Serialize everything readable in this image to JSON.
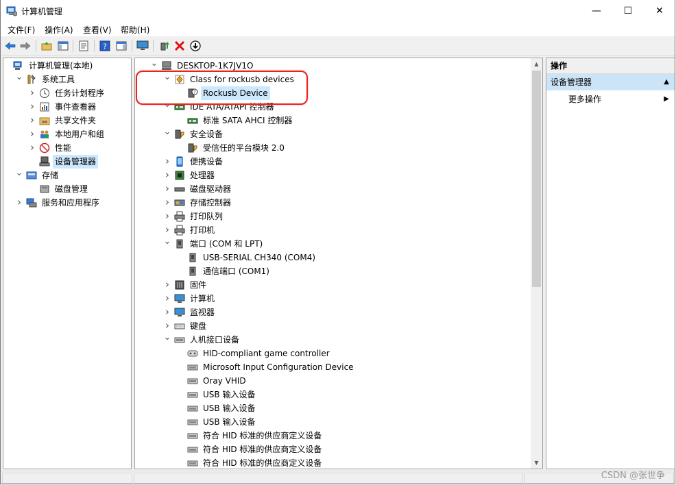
{
  "window": {
    "title": "计算机管理",
    "minimize_glyph": "—",
    "maximize_glyph": "☐",
    "close_glyph": "✕"
  },
  "menu": [
    "文件(F)",
    "操作(A)",
    "查看(V)",
    "帮助(H)"
  ],
  "toolbar_icons": [
    "back-arrow-icon",
    "forward-arrow-icon",
    "up-folder-icon",
    "show-hide-console-tree-icon",
    "properties-icon",
    "help-icon",
    "show-hide-action-pane-icon",
    "monitor-icon",
    "update-driver-icon",
    "uninstall-icon",
    "scan-hardware-icon"
  ],
  "left_tree": [
    {
      "label": "计算机管理(本地)",
      "indent": 0,
      "expand": "",
      "icon": "computer-management-icon"
    },
    {
      "label": "系统工具",
      "indent": 1,
      "expand": "v",
      "icon": "tools-icon"
    },
    {
      "label": "任务计划程序",
      "indent": 2,
      "expand": ">",
      "icon": "clock-icon"
    },
    {
      "label": "事件查看器",
      "indent": 2,
      "expand": ">",
      "icon": "event-viewer-icon"
    },
    {
      "label": "共享文件夹",
      "indent": 2,
      "expand": ">",
      "icon": "shared-folder-icon"
    },
    {
      "label": "本地用户和组",
      "indent": 2,
      "expand": ">",
      "icon": "users-icon"
    },
    {
      "label": "性能",
      "indent": 2,
      "expand": ">",
      "icon": "performance-icon"
    },
    {
      "label": "设备管理器",
      "indent": 2,
      "expand": "",
      "icon": "device-manager-icon",
      "selected": true
    },
    {
      "label": "存储",
      "indent": 1,
      "expand": "v",
      "icon": "storage-icon"
    },
    {
      "label": "磁盘管理",
      "indent": 2,
      "expand": "",
      "icon": "disk-management-icon"
    },
    {
      "label": "服务和应用程序",
      "indent": 1,
      "expand": ">",
      "icon": "services-icon"
    }
  ],
  "device_tree": [
    {
      "label": "DESKTOP-1K7JV1O",
      "indent": 0,
      "expand": "v",
      "icon": "computer-icon"
    },
    {
      "label": "Class for rockusb devices",
      "indent": 1,
      "expand": "v",
      "icon": "rockusb-class-icon"
    },
    {
      "label": "Rockusb Device",
      "indent": 2,
      "expand": "",
      "icon": "unknown-device-icon",
      "selected": true
    },
    {
      "label": "IDE ATA/ATAPI 控制器",
      "indent": 1,
      "expand": "v",
      "icon": "ide-controller-icon"
    },
    {
      "label": "标准 SATA AHCI 控制器",
      "indent": 2,
      "expand": "",
      "icon": "ide-controller-icon"
    },
    {
      "label": "安全设备",
      "indent": 1,
      "expand": "v",
      "icon": "security-device-icon"
    },
    {
      "label": "受信任的平台模块 2.0",
      "indent": 2,
      "expand": "",
      "icon": "security-device-icon"
    },
    {
      "label": "便携设备",
      "indent": 1,
      "expand": ">",
      "icon": "portable-device-icon"
    },
    {
      "label": "处理器",
      "indent": 1,
      "expand": ">",
      "icon": "processor-icon"
    },
    {
      "label": "磁盘驱动器",
      "indent": 1,
      "expand": ">",
      "icon": "disk-drive-icon"
    },
    {
      "label": "存储控制器",
      "indent": 1,
      "expand": ">",
      "icon": "storage-controller-icon"
    },
    {
      "label": "打印队列",
      "indent": 1,
      "expand": ">",
      "icon": "printer-icon"
    },
    {
      "label": "打印机",
      "indent": 1,
      "expand": ">",
      "icon": "printer-icon"
    },
    {
      "label": "端口 (COM 和 LPT)",
      "indent": 1,
      "expand": "v",
      "icon": "port-icon"
    },
    {
      "label": "USB-SERIAL CH340 (COM4)",
      "indent": 2,
      "expand": "",
      "icon": "port-icon"
    },
    {
      "label": "通信端口 (COM1)",
      "indent": 2,
      "expand": "",
      "icon": "port-icon"
    },
    {
      "label": "固件",
      "indent": 1,
      "expand": ">",
      "icon": "firmware-icon"
    },
    {
      "label": "计算机",
      "indent": 1,
      "expand": ">",
      "icon": "monitor-icon"
    },
    {
      "label": "监视器",
      "indent": 1,
      "expand": ">",
      "icon": "monitor-icon"
    },
    {
      "label": "键盘",
      "indent": 1,
      "expand": ">",
      "icon": "keyboard-icon"
    },
    {
      "label": "人机接口设备",
      "indent": 1,
      "expand": "v",
      "icon": "hid-icon"
    },
    {
      "label": "HID-compliant game controller",
      "indent": 2,
      "expand": "",
      "icon": "game-controller-icon"
    },
    {
      "label": "Microsoft Input Configuration Device",
      "indent": 2,
      "expand": "",
      "icon": "hid-icon"
    },
    {
      "label": "Oray VHID",
      "indent": 2,
      "expand": "",
      "icon": "hid-icon"
    },
    {
      "label": "USB 输入设备",
      "indent": 2,
      "expand": "",
      "icon": "hid-icon"
    },
    {
      "label": "USB 输入设备",
      "indent": 2,
      "expand": "",
      "icon": "hid-icon"
    },
    {
      "label": "USB 输入设备",
      "indent": 2,
      "expand": "",
      "icon": "hid-icon"
    },
    {
      "label": "符合 HID 标准的供应商定义设备",
      "indent": 2,
      "expand": "",
      "icon": "hid-icon"
    },
    {
      "label": "符合 HID 标准的供应商定义设备",
      "indent": 2,
      "expand": "",
      "icon": "hid-icon"
    },
    {
      "label": "符合 HID 标准的供应商定义设备",
      "indent": 2,
      "expand": "",
      "icon": "hid-icon"
    }
  ],
  "actions": {
    "header": "操作",
    "section": "设备管理器",
    "more": "更多操作"
  },
  "watermark": "CSDN @张世争",
  "colors": {
    "selection": "#cce8ff",
    "section": "#cce4f7",
    "highlight_box": "#e8221c"
  }
}
